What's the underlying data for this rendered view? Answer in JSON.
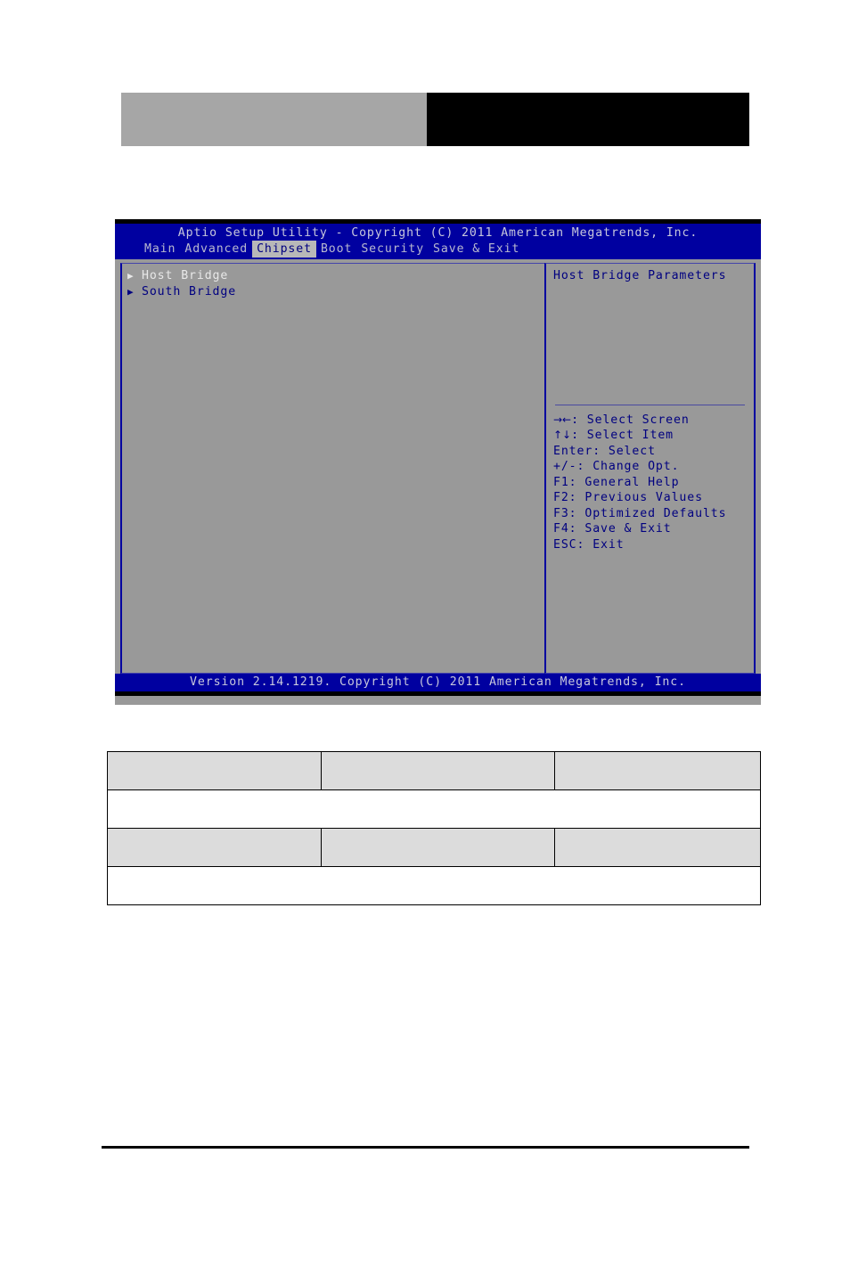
{
  "document": {
    "header_blocks": [
      {
        "name": "left-block",
        "fill": "#a6a6a6",
        "label": ""
      },
      {
        "name": "right-block",
        "fill": "#000000",
        "label": ""
      }
    ]
  },
  "bios": {
    "title": "Aptio Setup Utility - Copyright (C) 2011 American Megatrends, Inc.",
    "menu_tabs": [
      {
        "label": "Main",
        "active": false
      },
      {
        "label": "Advanced",
        "active": false
      },
      {
        "label": "Chipset",
        "active": true
      },
      {
        "label": "Boot",
        "active": false
      },
      {
        "label": "Security",
        "active": false
      },
      {
        "label": "Save & Exit",
        "active": false
      }
    ],
    "left_pane": {
      "items": [
        {
          "arrow": "▶",
          "label": "Host Bridge",
          "selected": true
        },
        {
          "arrow": "▶",
          "label": "South Bridge",
          "selected": false
        }
      ]
    },
    "right_pane": {
      "help_text": "Host Bridge Parameters",
      "key_legend": [
        {
          "glyph": "→←",
          "text": ": Select Screen"
        },
        {
          "glyph": "↑↓",
          "text": ": Select Item"
        },
        {
          "glyph": "",
          "text": "Enter: Select"
        },
        {
          "glyph": "",
          "text": "+/-: Change Opt."
        },
        {
          "glyph": "",
          "text": "F1: General Help"
        },
        {
          "glyph": "",
          "text": "F2: Previous Values"
        },
        {
          "glyph": "",
          "text": "F3: Optimized Defaults"
        },
        {
          "glyph": "",
          "text": "F4: Save & Exit"
        },
        {
          "glyph": "",
          "text": "ESC: Exit"
        }
      ]
    },
    "footer": "Version 2.14.1219. Copyright (C) 2011 American Megatrends, Inc.",
    "colors": {
      "chrome_blue": "#0000a0",
      "body_gray": "#999999",
      "title_text": "#c8c8dc",
      "item_text": "#000080",
      "selected_text": "#e8e8e8",
      "active_tab_bg": "#b8b8b8"
    }
  },
  "table": {
    "rows": [
      {
        "type": "columns",
        "shaded": true,
        "cells": [
          "",
          "",
          ""
        ]
      },
      {
        "type": "full",
        "shaded": false,
        "cells": [
          ""
        ]
      },
      {
        "type": "columns",
        "shaded": true,
        "cells": [
          "",
          "",
          ""
        ]
      },
      {
        "type": "full",
        "shaded": false,
        "cells": [
          ""
        ]
      }
    ]
  }
}
